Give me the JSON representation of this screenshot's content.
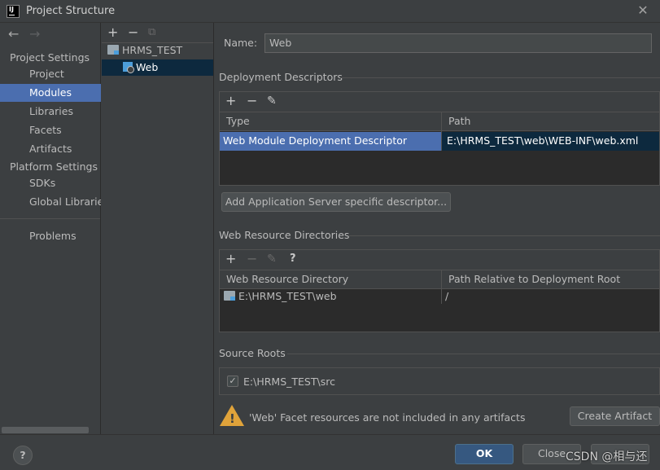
{
  "window": {
    "title": "Project Structure",
    "app_icon_text": "IJ"
  },
  "nav": {
    "back_icon": "←",
    "forward_icon": "→",
    "project_settings_header": "Project Settings",
    "items": [
      {
        "label": "Project"
      },
      {
        "label": "Modules",
        "selected": true
      },
      {
        "label": "Libraries"
      },
      {
        "label": "Facets"
      },
      {
        "label": "Artifacts"
      }
    ],
    "platform_settings_header": "Platform Settings",
    "platform_items": [
      {
        "label": "SDKs"
      },
      {
        "label": "Global Libraries"
      }
    ],
    "problems_label": "Problems"
  },
  "tree": {
    "toolbar": {
      "add": "+",
      "remove": "−",
      "copy": "⧉"
    },
    "nodes": [
      {
        "label": "HRMS_TEST"
      },
      {
        "label": "Web",
        "selected": true
      }
    ]
  },
  "facet": {
    "name_label": "Name:",
    "name_value": "Web",
    "deployment_descriptors": {
      "title": "Deployment Descriptors",
      "toolbar": {
        "add": "+",
        "remove": "−",
        "edit": "✎"
      },
      "columns": [
        "Type",
        "Path"
      ],
      "rows": [
        {
          "type": "Web Module Deployment Descriptor",
          "path": "E:\\HRMS_TEST\\web\\WEB-INF\\web.xml"
        }
      ],
      "add_server_descriptor_button": "Add Application Server specific descriptor..."
    },
    "web_resource_directories": {
      "title": "Web Resource Directories",
      "toolbar": {
        "add": "+",
        "remove": "−",
        "edit": "✎",
        "help": "?"
      },
      "columns": [
        "Web Resource Directory",
        "Path Relative to Deployment Root"
      ],
      "rows": [
        {
          "directory": "E:\\HRMS_TEST\\web",
          "relative_path": "/"
        }
      ]
    },
    "source_roots": {
      "title": "Source Roots",
      "items": [
        {
          "label": "E:\\HRMS_TEST\\src",
          "checked": true,
          "check_mark": "✓"
        }
      ]
    },
    "warning": {
      "icon_text": "!",
      "text": "'Web' Facet resources are not included in any artifacts",
      "button": "Create Artifact"
    }
  },
  "footer": {
    "help": "?",
    "ok": "OK",
    "close": "Close",
    "watermark": "CSDN @相与还"
  },
  "colors": {
    "background": "#3c3f41",
    "selection": "#4b6eaf",
    "table_body": "#2b2b2b",
    "primary_button": "#365880",
    "warning": "#e0a33a"
  }
}
